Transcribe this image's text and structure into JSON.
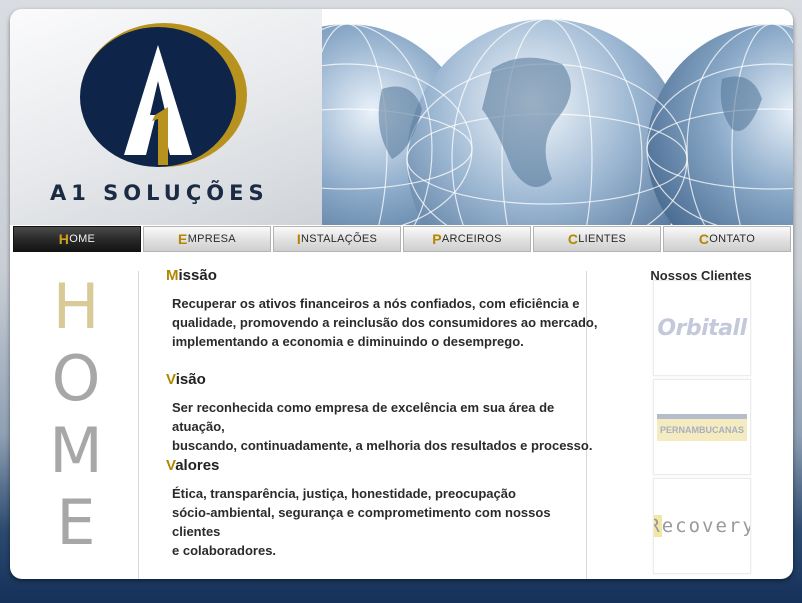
{
  "brand": {
    "name": "A1 SOLUÇÕES",
    "logo_letter": "A",
    "logo_number": "1"
  },
  "nav": {
    "items": [
      {
        "cap": "H",
        "rest": "OME",
        "active": true
      },
      {
        "cap": "E",
        "rest": "MPRESA",
        "active": false
      },
      {
        "cap": "I",
        "rest": "NSTALAÇÕES",
        "active": false
      },
      {
        "cap": "P",
        "rest": "ARCEIROS",
        "active": false
      },
      {
        "cap": "C",
        "rest": "LIENTES",
        "active": false
      },
      {
        "cap": "C",
        "rest": "ONTATO",
        "active": false
      }
    ]
  },
  "home_word": [
    "H",
    "O",
    "M",
    "E"
  ],
  "sections": {
    "missao": {
      "cap": "M",
      "rest": "issão",
      "lines": [
        "Recuperar os ativos financeiros a nós confiados, com eficiência e",
        "qualidade, promovendo a reinclusão dos consumidores ao mercado,",
        "implementando a economia e diminuindo o desemprego."
      ]
    },
    "visao": {
      "cap": "V",
      "rest": "isão",
      "lines": [
        "Ser reconhecida como empresa de excelência em sua área de atuação,",
        "buscando, continuadamente, a melhoria dos resultados e processo."
      ]
    },
    "valores": {
      "cap": "V",
      "rest": "alores",
      "lines": [
        "Ética, transparência, justiça, honestidade, preocupação",
        "sócio-ambiental, segurança e comprometimento com nossos clientes",
        "e colaboradores."
      ]
    }
  },
  "clients": {
    "title": "Nossos Clientes",
    "logos": [
      {
        "name": "orbitall-logo",
        "text": "Orbitall"
      },
      {
        "name": "pernambucanas-logo",
        "text": "PERNAMBUCANAS"
      },
      {
        "name": "recovery-logo",
        "first": "R",
        "rest": "ecovery"
      }
    ]
  },
  "colors": {
    "accent_gold": "#b08800",
    "logo_navy": "#0e2448",
    "logo_gold": "#b8921e",
    "nav_active": "#1c1c1c"
  }
}
